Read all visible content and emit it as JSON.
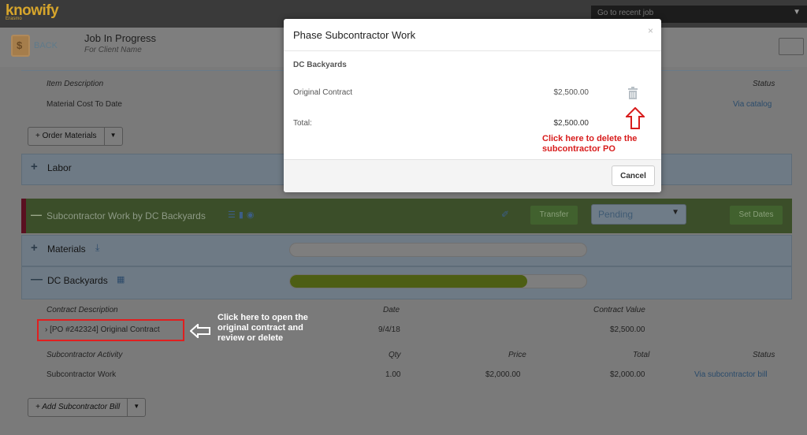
{
  "app": {
    "logo": "knowify",
    "logo_sub": "Erasmo",
    "recent_jobs_label": "Go to recent job"
  },
  "header": {
    "back_label": "BACK",
    "job_title": "Job In Progress",
    "client_name": "For Client Name"
  },
  "materials_table": {
    "col_item_description": "Item Description",
    "col_status": "Status",
    "row_label": "Material Cost To Date",
    "row_status": "Via catalog",
    "order_button": "+ Order Materials"
  },
  "labor_section": {
    "label": "Labor"
  },
  "subcontractor_section": {
    "title": "Subcontractor Work by DC Backyards",
    "transfer_label": "Transfer",
    "status_value": "Pending",
    "set_dates_label": "Set Dates",
    "materials_label": "Materials",
    "materials_progress": 0,
    "vendor_label": "DC Backyards",
    "vendor_progress": 0.8
  },
  "contract_table": {
    "col_description": "Contract Description",
    "col_date": "Date",
    "col_value": "Contract Value",
    "row_description": "[PO #242324] Original Contract",
    "row_date": "9/4/18",
    "row_value": "$2,500.00"
  },
  "activity_table": {
    "col_activity": "Subcontractor Activity",
    "col_qty": "Qty",
    "col_price": "Price",
    "col_total": "Total",
    "col_status": "Status",
    "row_activity": "Subcontractor Work",
    "row_qty": "1.00",
    "row_price": "$2,000.00",
    "row_total": "$2,000.00",
    "row_status": "Via subcontractor bill",
    "add_bill_button": "+ Add Subcontractor Bill"
  },
  "annotation_open": {
    "line1": "Click here to open the",
    "line2": "original contract and",
    "line3": "review or delete"
  },
  "modal": {
    "title": "Phase Subcontractor Work",
    "close": "×",
    "subcontractor": "DC Backyards",
    "line_label": "Original Contract",
    "line_amount": "$2,500.00",
    "total_label": "Total:",
    "total_amount": "$2,500.00",
    "cancel_label": "Cancel",
    "annotation_line1": "Click here to delete the",
    "annotation_line2": "subcontractor PO"
  },
  "colors": {
    "annotation_red": "#d81c1c",
    "link": "#2a4b6b"
  }
}
